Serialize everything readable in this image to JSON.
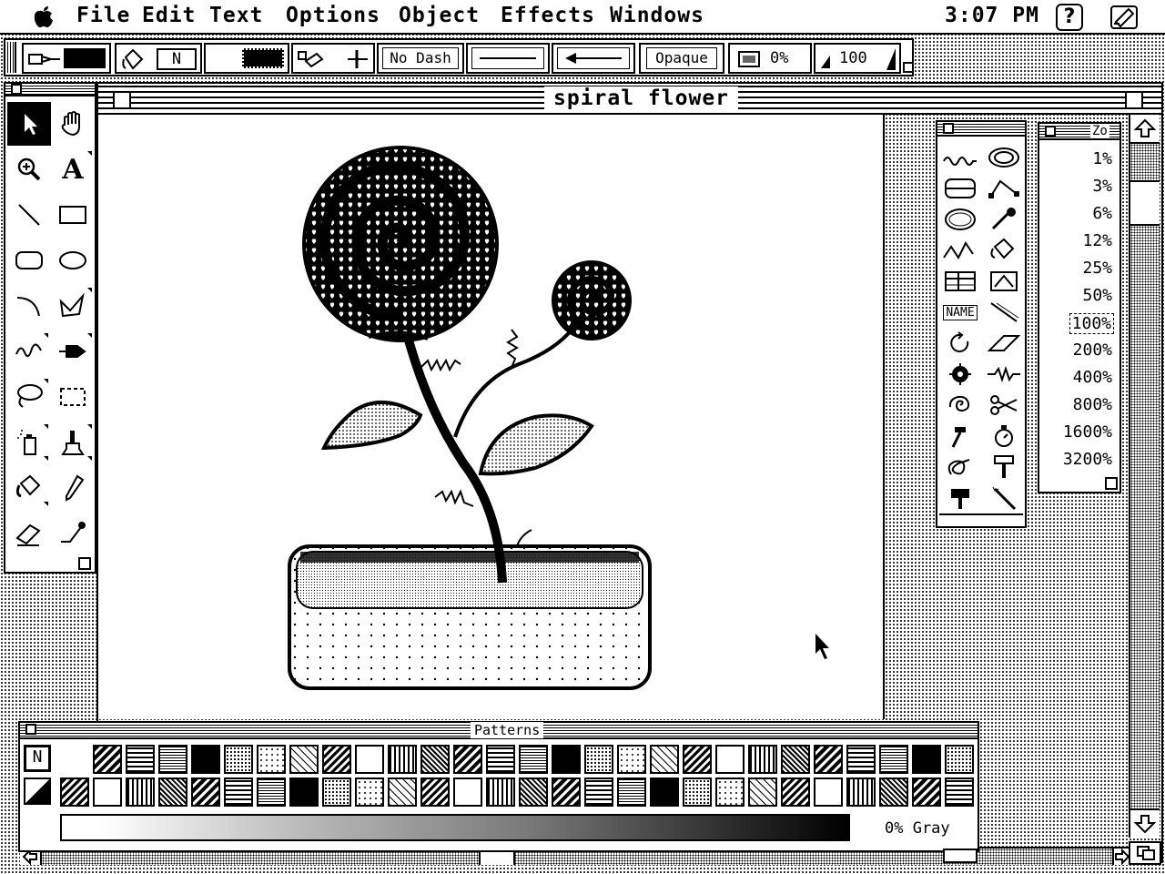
{
  "menubar": {
    "apple_icon": "apple-icon",
    "items": [
      "File",
      "Edit",
      "Text",
      "Options",
      "Object",
      "Effects",
      "Windows"
    ],
    "clock": "3:07 PM",
    "help_icon": "help-icon",
    "app_icon": "app-icon"
  },
  "control_palette": {
    "pen_color_icon": "pen-icon",
    "fill_mode": "N",
    "dash": "No Dash",
    "transfer_mode": "Opaque",
    "tint": "0%",
    "opacity_value": "100"
  },
  "toolbox": {
    "tools": [
      {
        "name": "arrow",
        "icon": "arrow-icon",
        "selected": true
      },
      {
        "name": "hand",
        "icon": "hand-icon"
      },
      {
        "name": "zoom",
        "icon": "magnifier-icon"
      },
      {
        "name": "text",
        "icon": "text-icon",
        "label": "A"
      },
      {
        "name": "line",
        "icon": "line-icon"
      },
      {
        "name": "rectangle",
        "icon": "rectangle-icon"
      },
      {
        "name": "rounded-rect",
        "icon": "rounded-rect-icon"
      },
      {
        "name": "oval",
        "icon": "oval-icon"
      },
      {
        "name": "arc",
        "icon": "arc-icon"
      },
      {
        "name": "polygon",
        "icon": "polygon-icon"
      },
      {
        "name": "freehand",
        "icon": "freehand-icon"
      },
      {
        "name": "pen",
        "icon": "pen-tool-icon"
      },
      {
        "name": "lasso",
        "icon": "lasso-icon"
      },
      {
        "name": "marquee",
        "icon": "marquee-icon"
      },
      {
        "name": "spray",
        "icon": "spraycan-icon"
      },
      {
        "name": "brush",
        "icon": "brush-icon"
      },
      {
        "name": "paint-bucket",
        "icon": "paint-bucket-icon"
      },
      {
        "name": "pencil",
        "icon": "pencil-icon"
      },
      {
        "name": "eraser",
        "icon": "eraser-icon"
      },
      {
        "name": "eyedropper",
        "icon": "eyedropper-icon"
      }
    ]
  },
  "document": {
    "title": "spiral flower"
  },
  "patterns_palette": {
    "title": "Patterns",
    "none_label": "N",
    "gray_value": "0% Gray"
  },
  "zoom_palette": {
    "title": "Zo",
    "levels": [
      "1%",
      "3%",
      "6%",
      "12%",
      "25%",
      "50%",
      "100%",
      "200%",
      "400%",
      "800%",
      "1600%",
      "3200%"
    ],
    "active": "100%"
  },
  "shapes_palette": {
    "name_label": "NAME"
  }
}
